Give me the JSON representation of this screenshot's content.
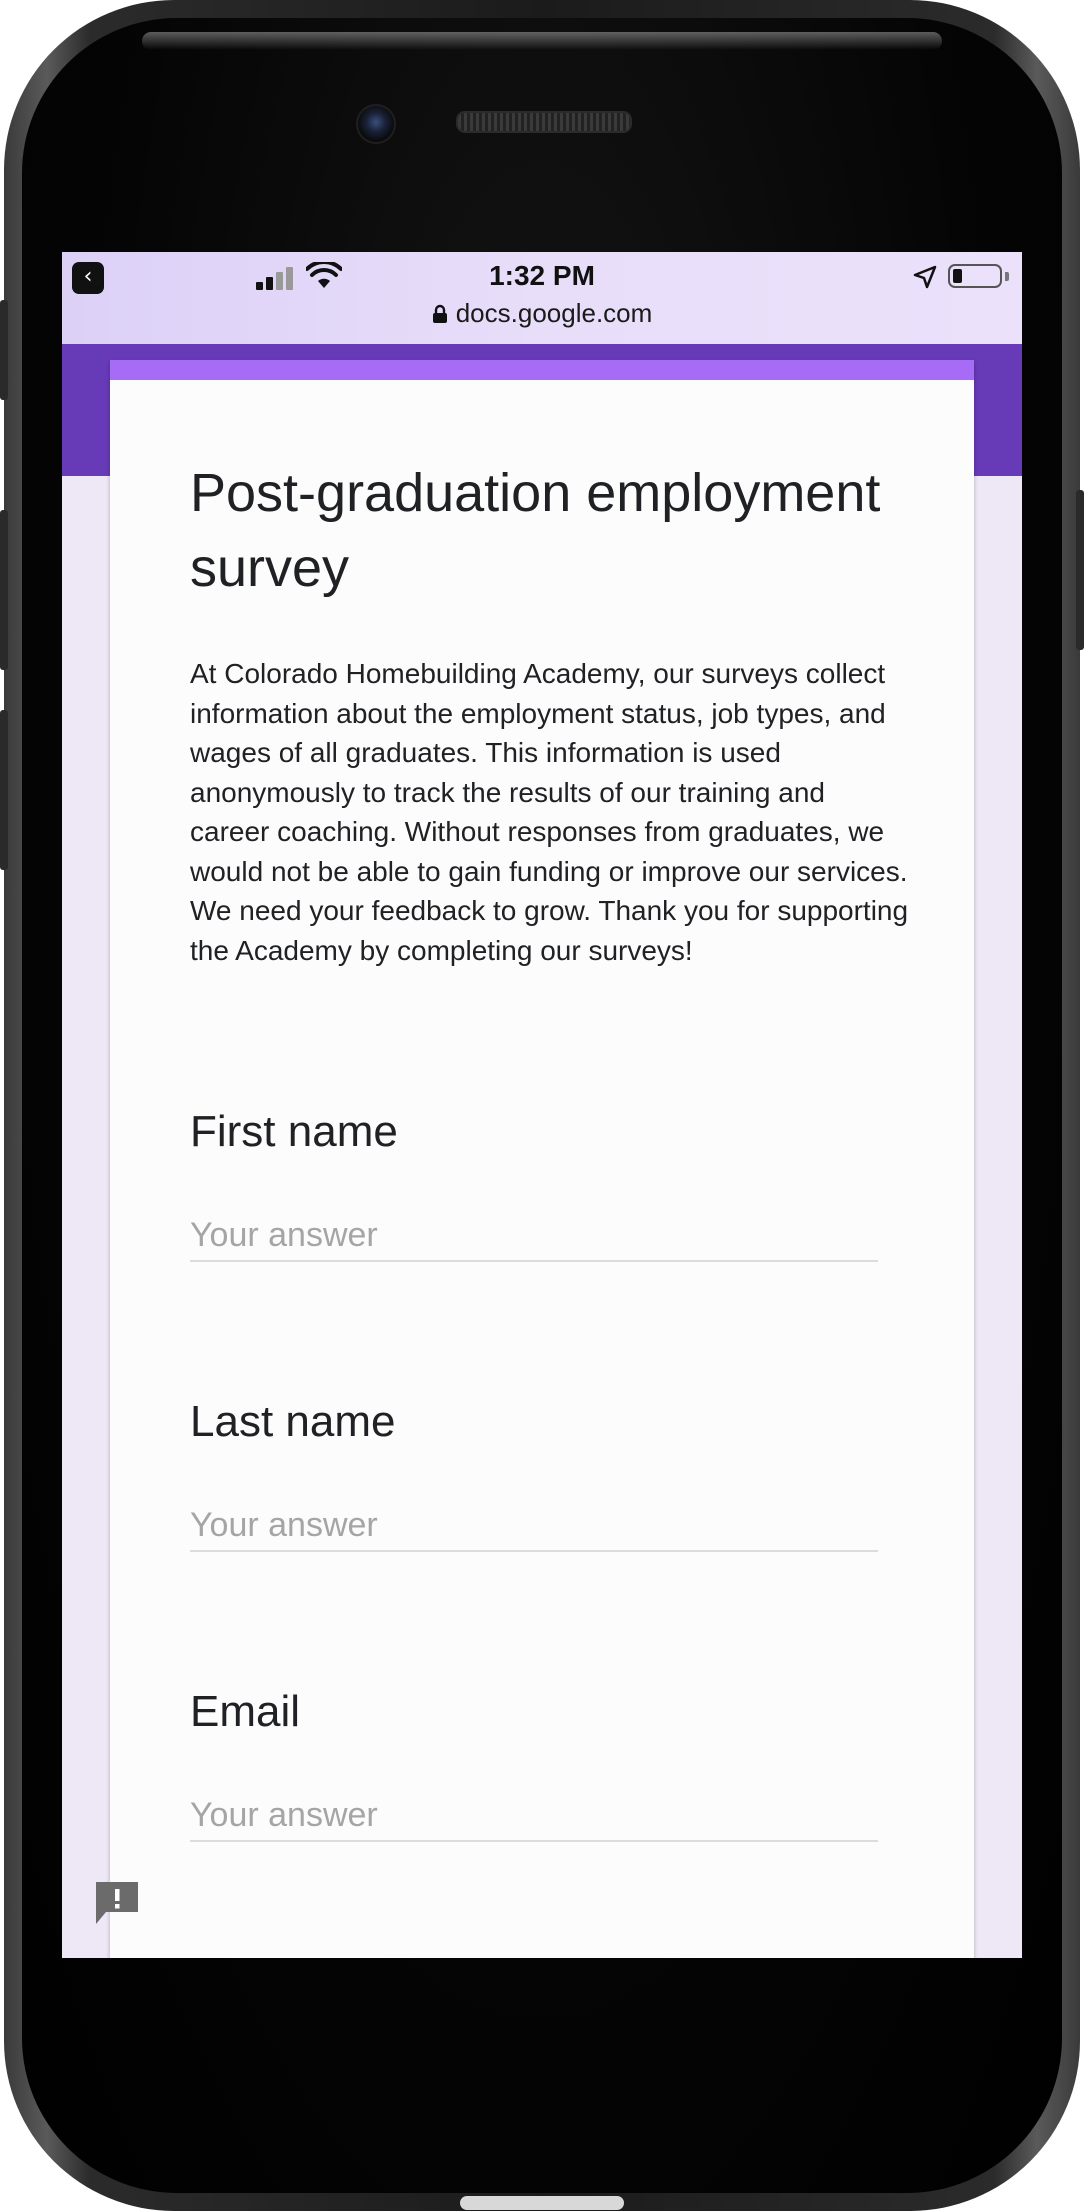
{
  "status_bar": {
    "time": "1:32 PM",
    "url": "docs.google.com"
  },
  "icons": {
    "back": "back-to-app-icon",
    "signal": "cellular-signal-icon",
    "wifi": "wifi-icon",
    "location": "location-arrow-icon",
    "battery": "battery-icon",
    "lock": "lock-icon",
    "report": "report-problem-icon"
  },
  "colors": {
    "header_purple": "#673ab7",
    "card_accent": "#a66cf5",
    "page_background": "#ede7f6"
  },
  "form": {
    "title": "Post-graduation employment survey",
    "description": "At Colorado Homebuilding Academy, our surveys collect information about the employment status, job types, and wages of all graduates. This information is used anonymously to track the results of our training and career coaching. Without responses from graduates, we would not be able to gain funding or improve our services. We need your feedback to grow. Thank you for supporting the Academy by completing our surveys!",
    "questions": [
      {
        "label": "First name",
        "placeholder": "Your answer",
        "value": ""
      },
      {
        "label": "Last name",
        "placeholder": "Your answer",
        "value": ""
      },
      {
        "label": "Email",
        "placeholder": "Your answer",
        "value": ""
      }
    ]
  }
}
